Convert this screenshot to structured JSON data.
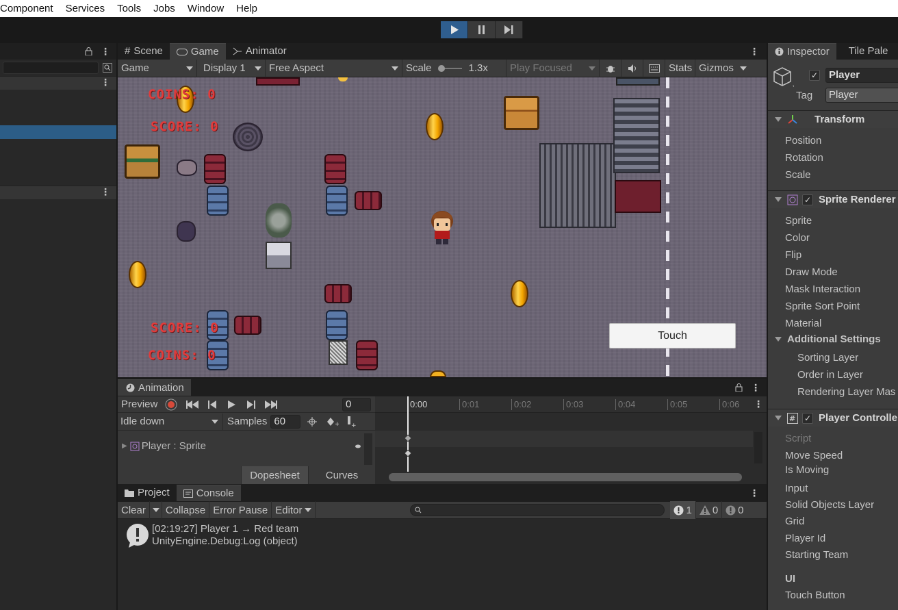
{
  "menu": [
    "Component",
    "Services",
    "Tools",
    "Jobs",
    "Window",
    "Help"
  ],
  "game_panel": {
    "tabs": [
      "Scene",
      "Game",
      "Animator"
    ],
    "display_mode": "Game",
    "display": "Display 1",
    "aspect": "Free Aspect",
    "scale_label": "Scale",
    "scale_value": "1.3x",
    "play_focused": "Play Focused",
    "stats": "Stats",
    "gizmos": "Gizmos"
  },
  "game_world": {
    "coins_top": "COINS: 0",
    "score_top": "SCORE: 0",
    "score_bottom": "SCORE: 0",
    "coins_bottom": "COINS: 0",
    "touch_button": "Touch"
  },
  "animation": {
    "tab": "Animation",
    "preview": "Preview",
    "frame": "0",
    "clip": "Idle down",
    "samples_label": "Samples",
    "samples": "60",
    "property": "Player : Sprite",
    "dopesheet": "Dopesheet",
    "curves": "Curves",
    "ticks": [
      "0:00",
      "0:01",
      "0:02",
      "0:03",
      "0:04",
      "0:05",
      "0:06"
    ]
  },
  "console": {
    "tabs": [
      "Project",
      "Console"
    ],
    "clear": "Clear",
    "collapse": "Collapse",
    "error_pause": "Error Pause",
    "editor": "Editor",
    "count_log": "1",
    "count_warn": "0",
    "count_error": "0",
    "entry_line1": "[02:19:27] Player 1 → Red team",
    "entry_line2": "UnityEngine.Debug:Log (object)"
  },
  "inspector": {
    "tabs": [
      "Inspector",
      "Tile Pale"
    ],
    "object_name": "Player",
    "tag_label": "Tag",
    "tag_value": "Player",
    "transform": {
      "title": "Transform",
      "props": [
        "Position",
        "Rotation",
        "Scale"
      ]
    },
    "sprite_renderer": {
      "title": "Sprite Renderer",
      "props": [
        "Sprite",
        "Color",
        "Flip",
        "Draw Mode",
        "Mask Interaction",
        "Sprite Sort Point",
        "Material"
      ],
      "additional": "Additional Settings",
      "sub_props": [
        "Sorting Layer",
        "Order in Layer",
        "Rendering Layer Mas"
      ]
    },
    "player_controller": {
      "title": "Player Controlle",
      "props": [
        "Script",
        "Move Speed",
        "Is Moving",
        "Input",
        "Solid Objects Layer",
        "Grid",
        "Player Id",
        "Starting Team"
      ],
      "ui_header": "UI",
      "touch_button": "Touch Button"
    }
  }
}
